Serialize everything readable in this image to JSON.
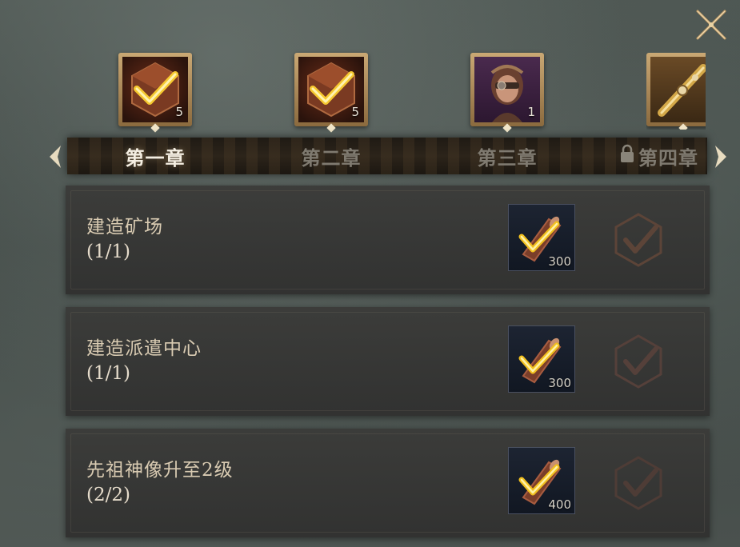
{
  "rewards": [
    {
      "icon": "wood-crate-check-icon",
      "count": "5"
    },
    {
      "icon": "wood-crate-check-icon",
      "count": "5"
    },
    {
      "icon": "hero-portrait-icon",
      "count": "1"
    },
    {
      "icon": "ornate-weapon-icon",
      "count": ""
    }
  ],
  "chapters": {
    "tabs": [
      {
        "label": "第一章",
        "state": "active",
        "locked": false
      },
      {
        "label": "第二章",
        "state": "inactive",
        "locked": false
      },
      {
        "label": "第三章",
        "state": "inactive",
        "locked": false
      },
      {
        "label": "第四章",
        "state": "inactive",
        "locked": true
      }
    ]
  },
  "tasks": [
    {
      "title": "建造矿场",
      "progress": "(1/1)",
      "reward_icon": "wood-log-icon",
      "reward_count": "300"
    },
    {
      "title": "建造派遣中心",
      "progress": "(1/1)",
      "reward_icon": "wood-log-icon",
      "reward_count": "300"
    },
    {
      "title": "先祖神像升至2级",
      "progress": "(2/2)",
      "reward_icon": "wood-log-icon",
      "reward_count": "400"
    }
  ],
  "colors": {
    "accent_gold": "#e8b628",
    "frame_gold": "#caa874",
    "claim_stamp": "#6b4a3a"
  }
}
